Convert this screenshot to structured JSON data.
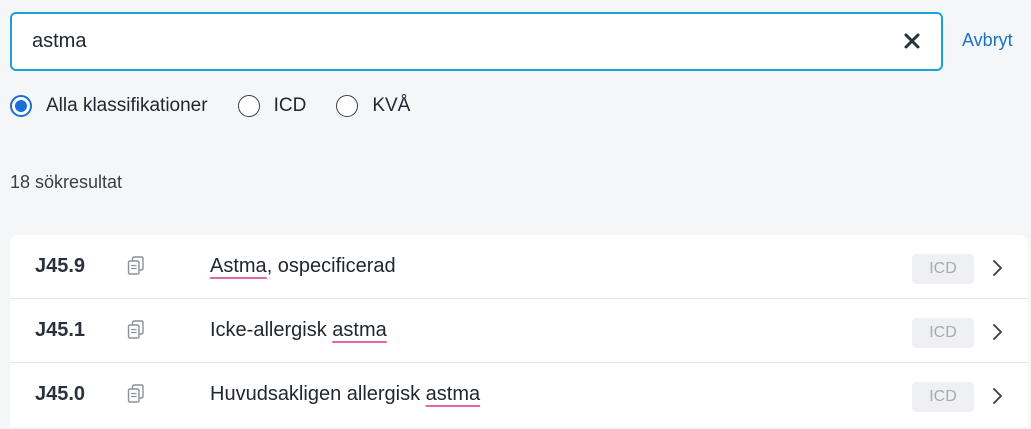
{
  "search": {
    "value": "astma",
    "placeholder": "",
    "clear_icon": "close-icon",
    "cancel_label": "Avbryt"
  },
  "filters": {
    "options": [
      {
        "label": "Alla klassifikationer",
        "selected": true
      },
      {
        "label": "ICD",
        "selected": false
      },
      {
        "label": "KVÅ",
        "selected": false
      }
    ]
  },
  "results": {
    "count_label": "18 sökresultat",
    "items": [
      {
        "code": "J45.9",
        "before": "",
        "match": "Astma",
        "after": ", ospecificerad",
        "badge": "ICD"
      },
      {
        "code": "J45.1",
        "before": "Icke-allergisk ",
        "match": "astma",
        "after": "",
        "badge": "ICD"
      },
      {
        "code": "J45.0",
        "before": "Huvudsakligen allergisk ",
        "match": "astma",
        "after": "",
        "badge": "ICD"
      }
    ]
  },
  "colors": {
    "accent": "#1a6fd8",
    "focus_border": "#1aa2d6",
    "link": "#1a73c4",
    "highlight_underline": "#e066a7"
  }
}
